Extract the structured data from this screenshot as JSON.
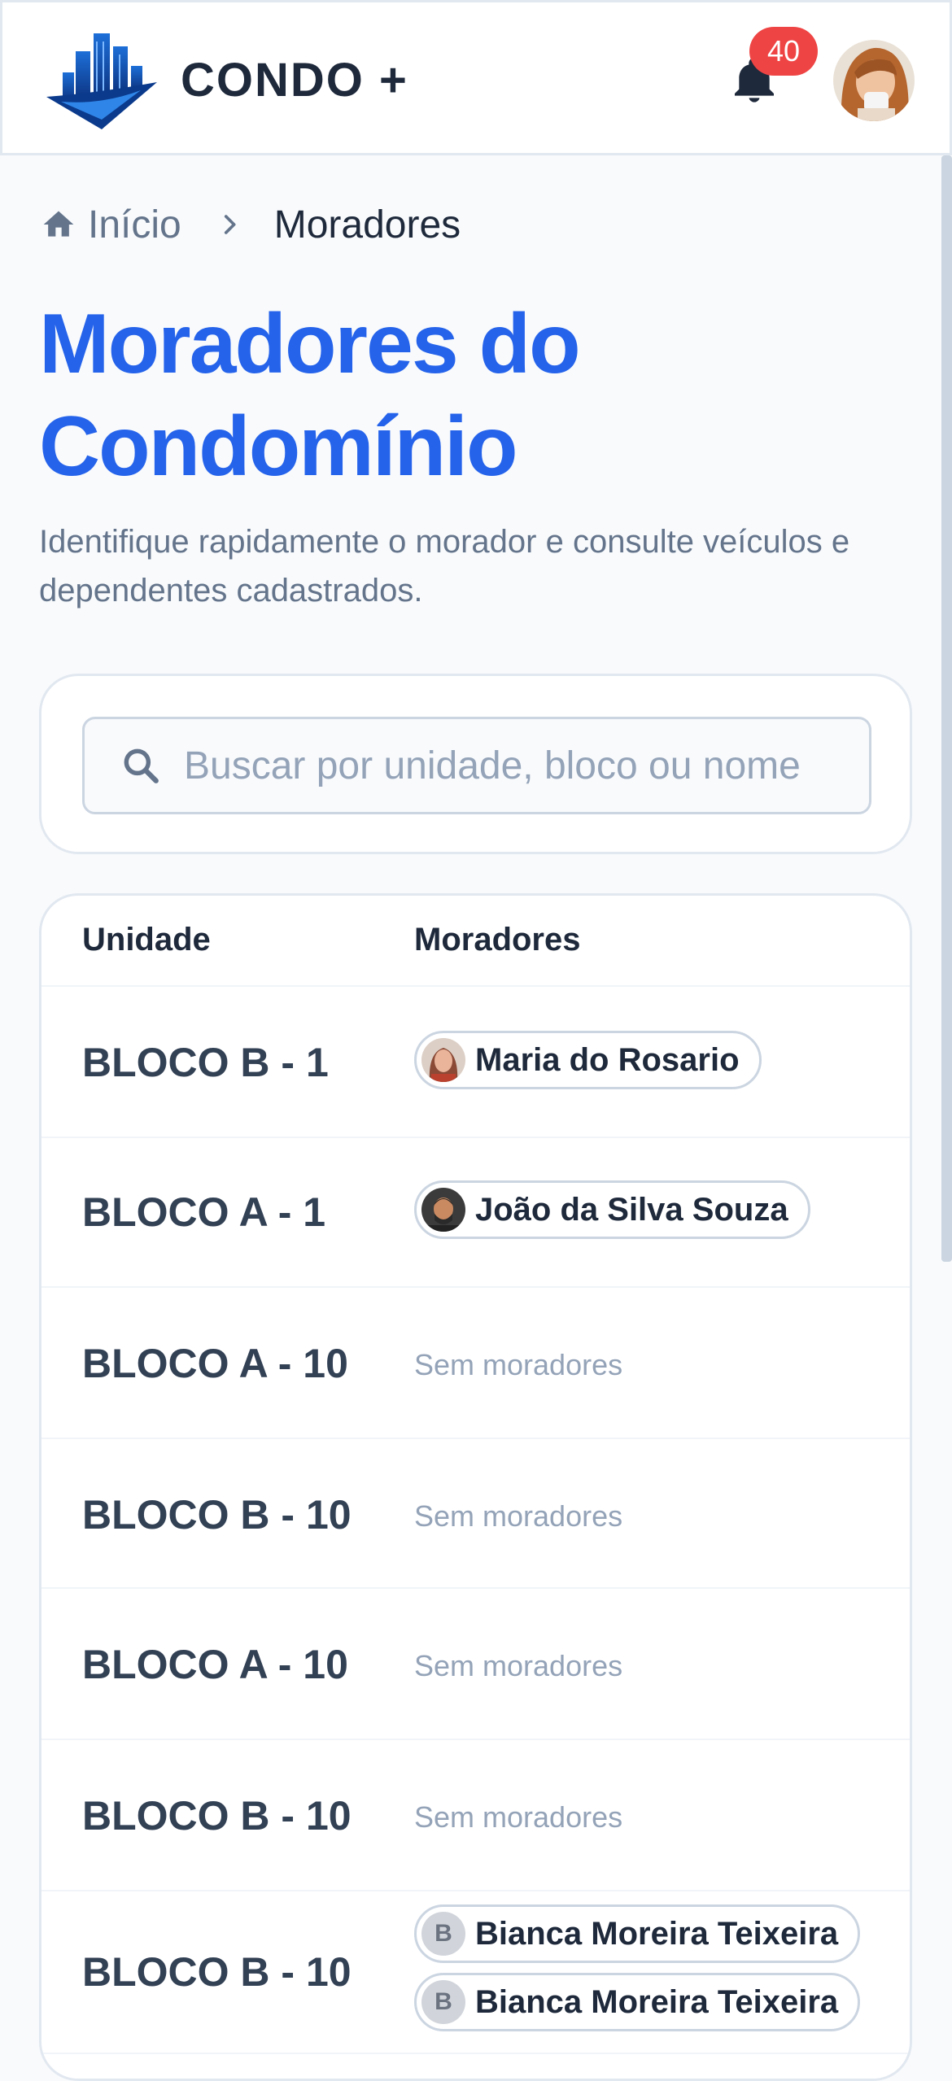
{
  "header": {
    "brand": "CONDO +",
    "notification_count": "40",
    "logo_icon": "building-logo-icon",
    "bell_icon": "bell-icon"
  },
  "breadcrumb": {
    "home": "Início",
    "current": "Moradores"
  },
  "page": {
    "title": "Moradores do Condomínio",
    "subtitle": "Identifique rapidamente o morador e consulte veículos e dependentes cadastrados."
  },
  "search": {
    "placeholder": "Buscar por unidade, bloco ou nome",
    "value": ""
  },
  "table": {
    "headers": {
      "unit": "Unidade",
      "residents": "Moradores"
    },
    "empty_label": "Sem moradores",
    "rows": [
      {
        "unit": "BLOCO B - 1",
        "residents": [
          "Maria do Rosario"
        ]
      },
      {
        "unit": "BLOCO A - 1",
        "residents": [
          "João da Silva Souza"
        ]
      },
      {
        "unit": "BLOCO A - 10",
        "residents": []
      },
      {
        "unit": "BLOCO B - 10",
        "residents": []
      },
      {
        "unit": "BLOCO A - 10",
        "residents": []
      },
      {
        "unit": "BLOCO B - 10",
        "residents": []
      },
      {
        "unit": "BLOCO B - 10",
        "residents": [
          "Bianca Moreira Teixeira",
          "Bianca Moreira Teixeira"
        ]
      }
    ],
    "avatar_initial": "B"
  },
  "colors": {
    "accent": "#2563eb",
    "badge": "#ef4444"
  }
}
